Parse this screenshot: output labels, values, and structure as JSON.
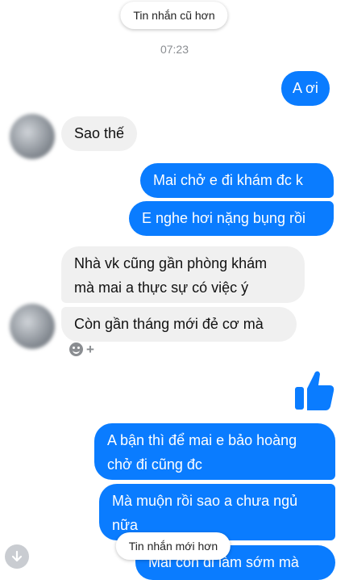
{
  "nav": {
    "older_label": "Tin nhắn cũ hơn",
    "newer_label": "Tin nhắn mới hơn"
  },
  "timestamp": "07:23",
  "messages": [
    {
      "side": "out",
      "text": "A ơi"
    },
    {
      "side": "in",
      "text": "Sao thế"
    },
    {
      "side": "out",
      "text": "Mai chở e đi khám đc k"
    },
    {
      "side": "out",
      "text": "E nghe hơi nặng bụng rồi"
    },
    {
      "side": "in",
      "lines": [
        "Nhà vk cũng gần phòng khám",
        "mà mai a thực sự có việc ý"
      ]
    },
    {
      "side": "in",
      "text": "Còn gần tháng mới đẻ cơ mà"
    },
    {
      "side": "out",
      "type": "like"
    },
    {
      "side": "out",
      "lines": [
        "A bận thì để mai e bảo hoàng",
        "chở đi cũng đc"
      ]
    },
    {
      "side": "out",
      "lines": [
        "Mà muộn rồi sao a chưa ngủ",
        "nữa"
      ]
    },
    {
      "side": "out",
      "text": "Mai còn đi làm sớm mà"
    }
  ],
  "icons": {
    "like": "thumbs-up-icon",
    "reaction": "smiley-icon",
    "add_reaction": "plus-icon",
    "scroll_down": "arrow-down-icon"
  },
  "colors": {
    "outgoing_bubble": "#0a7cff",
    "incoming_bubble": "#f0f0f0",
    "timestamp": "#8a8d91"
  }
}
